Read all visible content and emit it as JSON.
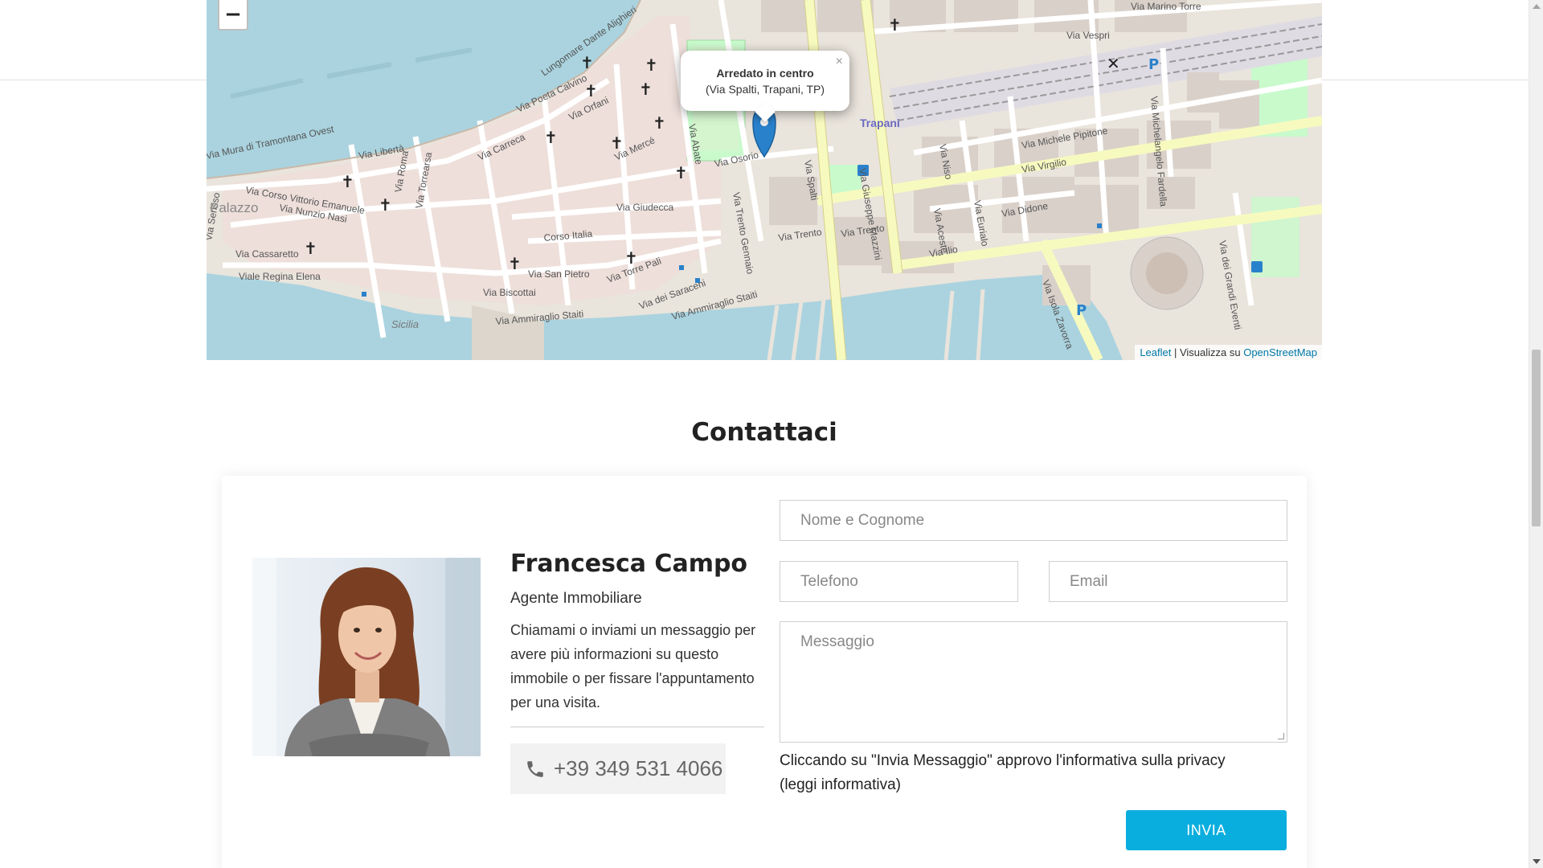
{
  "map": {
    "zoom_out_label": "−",
    "popup": {
      "title": "Arredato in centro",
      "address": "(Via Spalti, Trapani, TP)",
      "close_label": "×"
    },
    "attribution": {
      "leaflet": "Leaflet",
      "separator": " | Visualizza su ",
      "osm": "OpenStreetMap"
    },
    "labels": {
      "trapani": "Trapani",
      "palazzo": "Palazzo",
      "sicilia": "Sicilia",
      "streets": [
        "Lungomare Dante Alighieri",
        "Via Marino Torre",
        "Via Vespri",
        "Via Mura di Tramontana Ovest",
        "Via Libertà",
        "Via Poeta Calvino",
        "Via Orfani",
        "Via Carreca",
        "Corso Vittorio Emanuele",
        "Via Nunzio Nasi",
        "Via Roma",
        "Via Torrearsa",
        "Via Mercé",
        "Via Giudecca",
        "Corso Italia",
        "Via Cassaretto",
        "Viale Regina Elena",
        "Via Biscottai",
        "Via San Pietro",
        "Via Torre Pali",
        "Via dei Saraceni",
        "Via Ammiraglio Staiti",
        "Via Osorio",
        "Via Spalti",
        "Via Giuseppe Mazzini",
        "Via Trento",
        "Via Virgilio",
        "Via Michele Pipitone",
        "Via Michelangelo Fardella",
        "Via Didone",
        "Via Ilio",
        "Via Isola Zavorra",
        "Via dei Grandi Eventi",
        "Via Niso",
        "Via Eurialo",
        "Via Aceste",
        "Via Abate",
        "Via Trento Gennaio",
        "Via Serisso"
      ]
    }
  },
  "contact": {
    "title": "Contattaci",
    "agent": {
      "name": "Francesca Campo",
      "role": "Agente Immobiliare",
      "description": "Chiamami o inviami un messaggio per avere più informazioni su questo immobile o per fissare l'appuntamento per una visita.",
      "phone": "+39 349 531 4066"
    },
    "form": {
      "name_placeholder": "Nome e Cognome",
      "phone_placeholder": "Telefono",
      "email_placeholder": "Email",
      "message_placeholder": "Messaggio",
      "privacy_text": "Cliccando su \"Invia Messaggio\" approvo l'informativa sulla privacy",
      "privacy_link": "(leggi informativa)",
      "submit_label": "INVIA"
    }
  },
  "colors": {
    "accent": "#0aaede",
    "marker": "#2a81cb",
    "water": "#aad3df",
    "land": "#e9e4dc",
    "road_yellow": "#f7fabf",
    "park": "#c8facc",
    "link": "#0078a8"
  }
}
